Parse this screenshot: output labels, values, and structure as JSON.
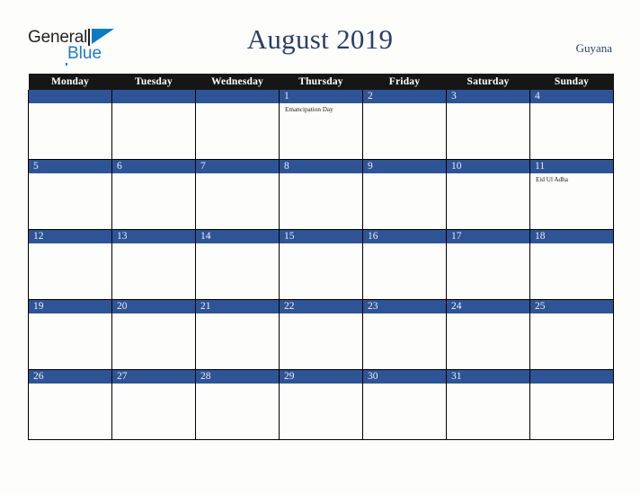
{
  "logo": {
    "text_top": "General",
    "text_bottom": "Blue",
    "mark": "triangle-logo-icon"
  },
  "header": {
    "title": "August 2019",
    "country": "Guyana"
  },
  "calendar": {
    "weekday_headers": [
      "Monday",
      "Tuesday",
      "Wednesday",
      "Thursday",
      "Friday",
      "Saturday",
      "Sunday"
    ],
    "colors": {
      "header_bg": "#161616",
      "header_text": "#ffffff",
      "day_bar": "#2e5496",
      "day_number": "#e9eef7",
      "title": "#2c3e66",
      "page_bg": "#fdfdfb",
      "grid_line": "#000000",
      "logo_blue": "#1c7cc4"
    },
    "weeks": [
      [
        {
          "day": "",
          "events": []
        },
        {
          "day": "",
          "events": []
        },
        {
          "day": "",
          "events": []
        },
        {
          "day": "1",
          "events": [
            "Emancipation Day"
          ]
        },
        {
          "day": "2",
          "events": []
        },
        {
          "day": "3",
          "events": []
        },
        {
          "day": "4",
          "events": []
        }
      ],
      [
        {
          "day": "5",
          "events": []
        },
        {
          "day": "6",
          "events": []
        },
        {
          "day": "7",
          "events": []
        },
        {
          "day": "8",
          "events": []
        },
        {
          "day": "9",
          "events": []
        },
        {
          "day": "10",
          "events": []
        },
        {
          "day": "11",
          "events": [
            "Eid Ul Adha"
          ]
        }
      ],
      [
        {
          "day": "12",
          "events": []
        },
        {
          "day": "13",
          "events": []
        },
        {
          "day": "14",
          "events": []
        },
        {
          "day": "15",
          "events": []
        },
        {
          "day": "16",
          "events": []
        },
        {
          "day": "17",
          "events": []
        },
        {
          "day": "18",
          "events": []
        }
      ],
      [
        {
          "day": "19",
          "events": []
        },
        {
          "day": "20",
          "events": []
        },
        {
          "day": "21",
          "events": []
        },
        {
          "day": "22",
          "events": []
        },
        {
          "day": "23",
          "events": []
        },
        {
          "day": "24",
          "events": []
        },
        {
          "day": "25",
          "events": []
        }
      ],
      [
        {
          "day": "26",
          "events": []
        },
        {
          "day": "27",
          "events": []
        },
        {
          "day": "28",
          "events": []
        },
        {
          "day": "29",
          "events": []
        },
        {
          "day": "30",
          "events": []
        },
        {
          "day": "31",
          "events": []
        },
        {
          "day": "",
          "events": []
        }
      ]
    ]
  }
}
